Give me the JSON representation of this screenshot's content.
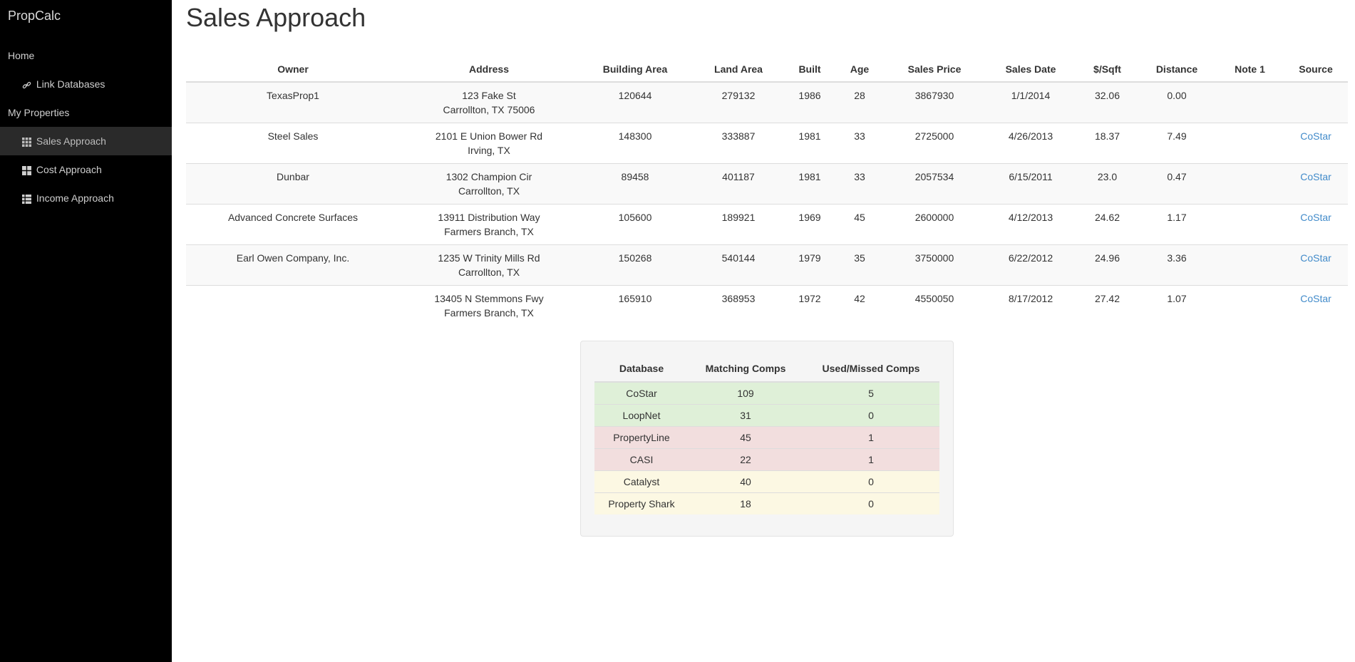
{
  "app": {
    "brand": "PropCalc"
  },
  "sidebar": {
    "items": [
      {
        "label": "Home",
        "icon": "none"
      },
      {
        "label": "Link Databases",
        "icon": "link-icon"
      },
      {
        "label": "My Properties",
        "icon": "none"
      },
      {
        "label": "Sales Approach",
        "icon": "th-grid-icon",
        "active": true
      },
      {
        "label": "Cost Approach",
        "icon": "th-large-icon"
      },
      {
        "label": "Income Approach",
        "icon": "th-list-icon"
      }
    ]
  },
  "page": {
    "title": "Sales Approach"
  },
  "comps_table": {
    "headers": [
      "Owner",
      "Address",
      "Building Area",
      "Land Area",
      "Built",
      "Age",
      "Sales Price",
      "Sales Date",
      "$/Sqft",
      "Distance",
      "Note 1",
      "Source"
    ],
    "rows": [
      {
        "owner": "TexasProp1",
        "address1": "123 Fake St",
        "address2": "Carrollton, TX 75006",
        "building_area": "120644",
        "land_area": "279132",
        "built": "1986",
        "age": "28",
        "sales_price": "3867930",
        "sales_date": "1/1/2014",
        "per_sqft": "32.06",
        "distance": "0.00",
        "note1": "",
        "source": ""
      },
      {
        "owner": "Steel Sales",
        "address1": "2101 E Union Bower Rd",
        "address2": "Irving, TX",
        "building_area": "148300",
        "land_area": "333887",
        "built": "1981",
        "age": "33",
        "sales_price": "2725000",
        "sales_date": "4/26/2013",
        "per_sqft": "18.37",
        "distance": "7.49",
        "note1": "",
        "source": "CoStar"
      },
      {
        "owner": "Dunbar",
        "address1": "1302 Champion Cir",
        "address2": "Carrollton, TX",
        "building_area": "89458",
        "land_area": "401187",
        "built": "1981",
        "age": "33",
        "sales_price": "2057534",
        "sales_date": "6/15/2011",
        "per_sqft": "23.0",
        "distance": "0.47",
        "note1": "",
        "source": "CoStar"
      },
      {
        "owner": "Advanced Concrete Surfaces",
        "address1": "13911 Distribution Way",
        "address2": "Farmers Branch, TX",
        "building_area": "105600",
        "land_area": "189921",
        "built": "1969",
        "age": "45",
        "sales_price": "2600000",
        "sales_date": "4/12/2013",
        "per_sqft": "24.62",
        "distance": "1.17",
        "note1": "",
        "source": "CoStar"
      },
      {
        "owner": "Earl Owen Company, Inc.",
        "address1": "1235 W Trinity Mills Rd",
        "address2": "Carrollton, TX",
        "building_area": "150268",
        "land_area": "540144",
        "built": "1979",
        "age": "35",
        "sales_price": "3750000",
        "sales_date": "6/22/2012",
        "per_sqft": "24.96",
        "distance": "3.36",
        "note1": "",
        "source": "CoStar"
      },
      {
        "owner": "",
        "address1": "13405 N Stemmons Fwy",
        "address2": "Farmers Branch, TX",
        "building_area": "165910",
        "land_area": "368953",
        "built": "1972",
        "age": "42",
        "sales_price": "4550050",
        "sales_date": "8/17/2012",
        "per_sqft": "27.42",
        "distance": "1.07",
        "note1": "",
        "source": "CoStar"
      }
    ]
  },
  "db_table": {
    "headers": [
      "Database",
      "Matching Comps",
      "Used/Missed Comps"
    ],
    "rows": [
      {
        "database": "CoStar",
        "matching": "109",
        "used_missed": "5",
        "status": "success"
      },
      {
        "database": "LoopNet",
        "matching": "31",
        "used_missed": "0",
        "status": "success"
      },
      {
        "database": "PropertyLine",
        "matching": "45",
        "used_missed": "1",
        "status": "danger"
      },
      {
        "database": "CASI",
        "matching": "22",
        "used_missed": "1",
        "status": "danger"
      },
      {
        "database": "Catalyst",
        "matching": "40",
        "used_missed": "0",
        "status": "warning"
      },
      {
        "database": "Property Shark",
        "matching": "18",
        "used_missed": "0",
        "status": "warning"
      }
    ],
    "status_colors": {
      "success": "#dff0d8",
      "danger": "#f2dede",
      "warning": "#fcf8e3"
    }
  },
  "colors": {
    "sidebar_bg": "#000000",
    "link": "#428bca",
    "active_nav": "#2a2a2a"
  }
}
